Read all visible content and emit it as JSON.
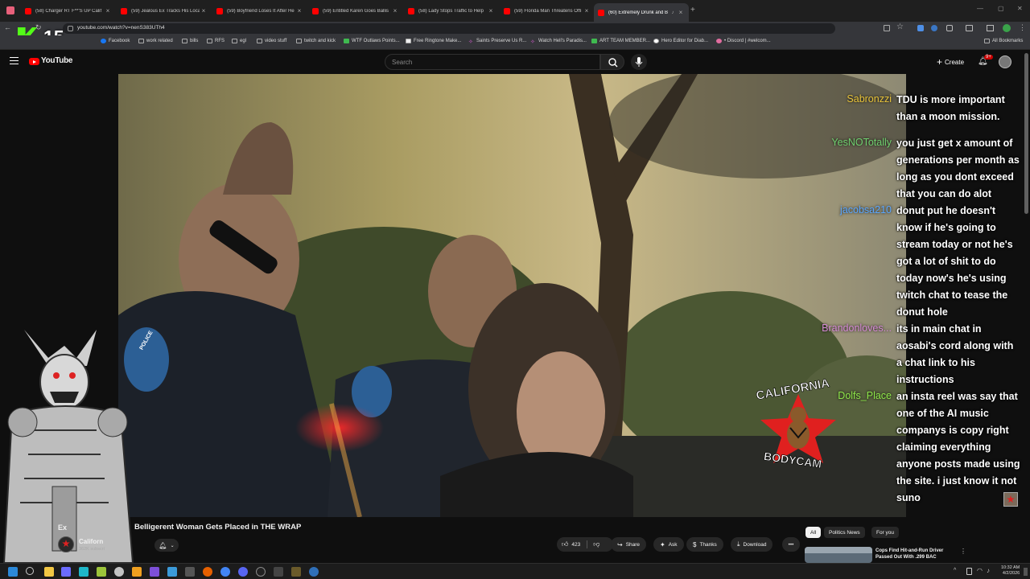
{
  "browser": {
    "tabs": [
      {
        "title": "(58) Charger RT F**'S UP Calif"
      },
      {
        "title": "(59) Jealous Ex Tracks His Loca"
      },
      {
        "title": "(59) Boyfriend Loses It After He"
      },
      {
        "title": "(59) Entitled Karen Goes Ballis"
      },
      {
        "title": "(58) Lady Stops Traffic to Help"
      },
      {
        "title": "(59) Florida Man Threatens Offi"
      },
      {
        "title": "(60) Extremely Drunk and B"
      }
    ],
    "url": "youtube.com/watch?v=nenS383UTh4",
    "bookmarks": [
      "Facebook",
      "work related",
      "bills",
      "RFS",
      "egl",
      "video stuff",
      "twitch and kick",
      "WTF Outlaws Points...",
      "Free Ringtone Make...",
      "Saints Preserve Us R...",
      "Watch Hell's Paradis...",
      "ART TEAM MEMBER...",
      "Hero Editor for Diab...",
      "• Discord | #welcom...",
      "All Bookmarks"
    ],
    "overlay_counter": "15"
  },
  "youtube": {
    "logo_text": "YouTube",
    "search_placeholder": "Search",
    "create_label": "Create",
    "notification_count": "9+"
  },
  "chat": [
    {
      "user": "Sabronzzi",
      "user_color": "#e8c33a",
      "lines": [
        "TDU is more important",
        "than a moon mission."
      ]
    },
    {
      "user": "YesNOTotally",
      "user_color": "#6fd06f",
      "lines": [
        "you just get x amount of",
        "generations per month as",
        "long as you dont exceed",
        "that you can do alot"
      ]
    },
    {
      "user": "jacobsa210",
      "user_color": "#5ba7ff",
      "lines": [
        "donut put he doesn't",
        "know if he's going to",
        "stream today or not he's",
        "got a lot of shit to do",
        "today now's he's using",
        "twitch chat to tease the",
        "donut hole"
      ]
    },
    {
      "user": "Brandonloves...",
      "user_color": "#d58ad5",
      "lines": [
        "its in main chat in",
        "aosabi's cord along with",
        "a chat link to his",
        "instructions"
      ]
    },
    {
      "user": "Dolfs_Place",
      "user_color": "#8fe84a",
      "lines": [
        "an insta reel was say that",
        "one of the AI music",
        "companys is copy right",
        "claiming everything",
        "anyone posts made using",
        "the site. i just know it not",
        "suno"
      ]
    }
  ],
  "video": {
    "watermark_top": "CALIFORNIA",
    "watermark_bottom": "BODYCAM",
    "badge_text": "POLICE"
  },
  "watch": {
    "title_prefix": "Ex",
    "title": "Belligerent Woman Gets Placed in THE WRAP",
    "channel_name": "Californ",
    "subscribers": "362K subscri",
    "like_count": "423",
    "share_label": "Share",
    "ask_label": "Ask",
    "thanks_label": "Thanks",
    "download_label": "Download",
    "more_label": "•••"
  },
  "related": {
    "chips": [
      "All",
      "Politics News",
      "For you"
    ],
    "first_video_title_line1": "Cops Find Hit-and-Run Driver",
    "first_video_title_line2": "Passed Out With .299 BAC"
  },
  "taskbar": {
    "time": "10:32 AM",
    "date": "4/2/2026"
  }
}
